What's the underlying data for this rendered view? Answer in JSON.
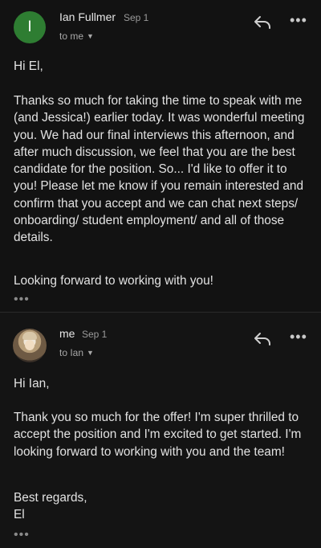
{
  "messages": [
    {
      "avatar_letter": "I",
      "avatar_color": "#2e7d32",
      "sender": "Ian Fullmer",
      "date": "Sep 1",
      "recipient": "to me",
      "body_greeting": "Hi El,",
      "body_paragraph": "Thanks so much for taking the time to speak with me (and Jessica!) earlier today. It was wonderful meeting you. We had our final interviews this afternoon, and after much discussion, we feel that you are the best candidate for the position. So... I'd like to offer it to you! Please let me know if you remain interested and confirm that you accept and we can chat next steps/ onboarding/ student employment/ and all of those details.",
      "body_closing": "Looking forward to working with you!",
      "trimmed_indicator": "•••"
    },
    {
      "avatar": "user-photo",
      "sender": "me",
      "date": "Sep 1",
      "recipient": "to Ian",
      "body_greeting": "Hi Ian,",
      "body_paragraph": "Thank you so much for the offer! I'm super thrilled to accept the position and I'm excited to get started. I'm looking forward to working with you and the team!",
      "body_closing": "Best regards,\nEl",
      "trimmed_indicator": "•••"
    }
  ],
  "actions": {
    "reply_icon": "reply-icon",
    "more_icon": "more-vertical-dots-icon",
    "more_glyph": "•••"
  },
  "colors": {
    "background": "#000000",
    "card": "#121212",
    "text": "#e2e2e2",
    "muted": "#9a9a9a"
  }
}
